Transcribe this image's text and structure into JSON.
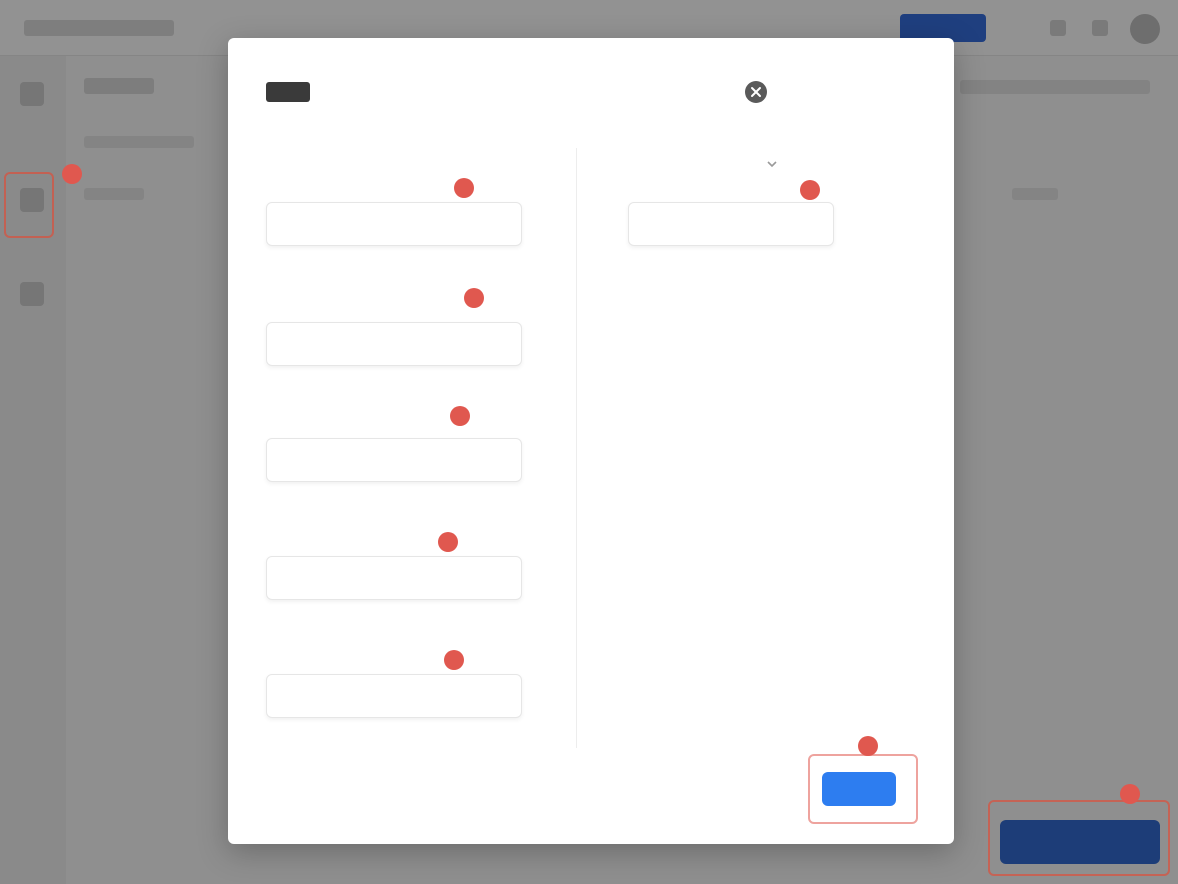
{
  "modal": {
    "title_tag": "",
    "title": "",
    "title_id": "",
    "left_fields": [
      {
        "label": "",
        "value": "",
        "step": ""
      },
      {
        "label": "",
        "value": "",
        "step": ""
      },
      {
        "label": "",
        "value": "",
        "step": ""
      },
      {
        "label": "",
        "value": "",
        "step": ""
      },
      {
        "label": "",
        "value": "",
        "step": "",
        "hint": ""
      }
    ],
    "right_field": {
      "label": "",
      "value": "",
      "step": ""
    },
    "cancel_label": "",
    "ok_label": "",
    "ok_step": ""
  },
  "background": {
    "bottom_button_step": "",
    "sidebar_step": ""
  },
  "colors": {
    "primary": "#2d7df0",
    "step_marker": "#e0584f",
    "overlay": "#8f8f8f"
  }
}
